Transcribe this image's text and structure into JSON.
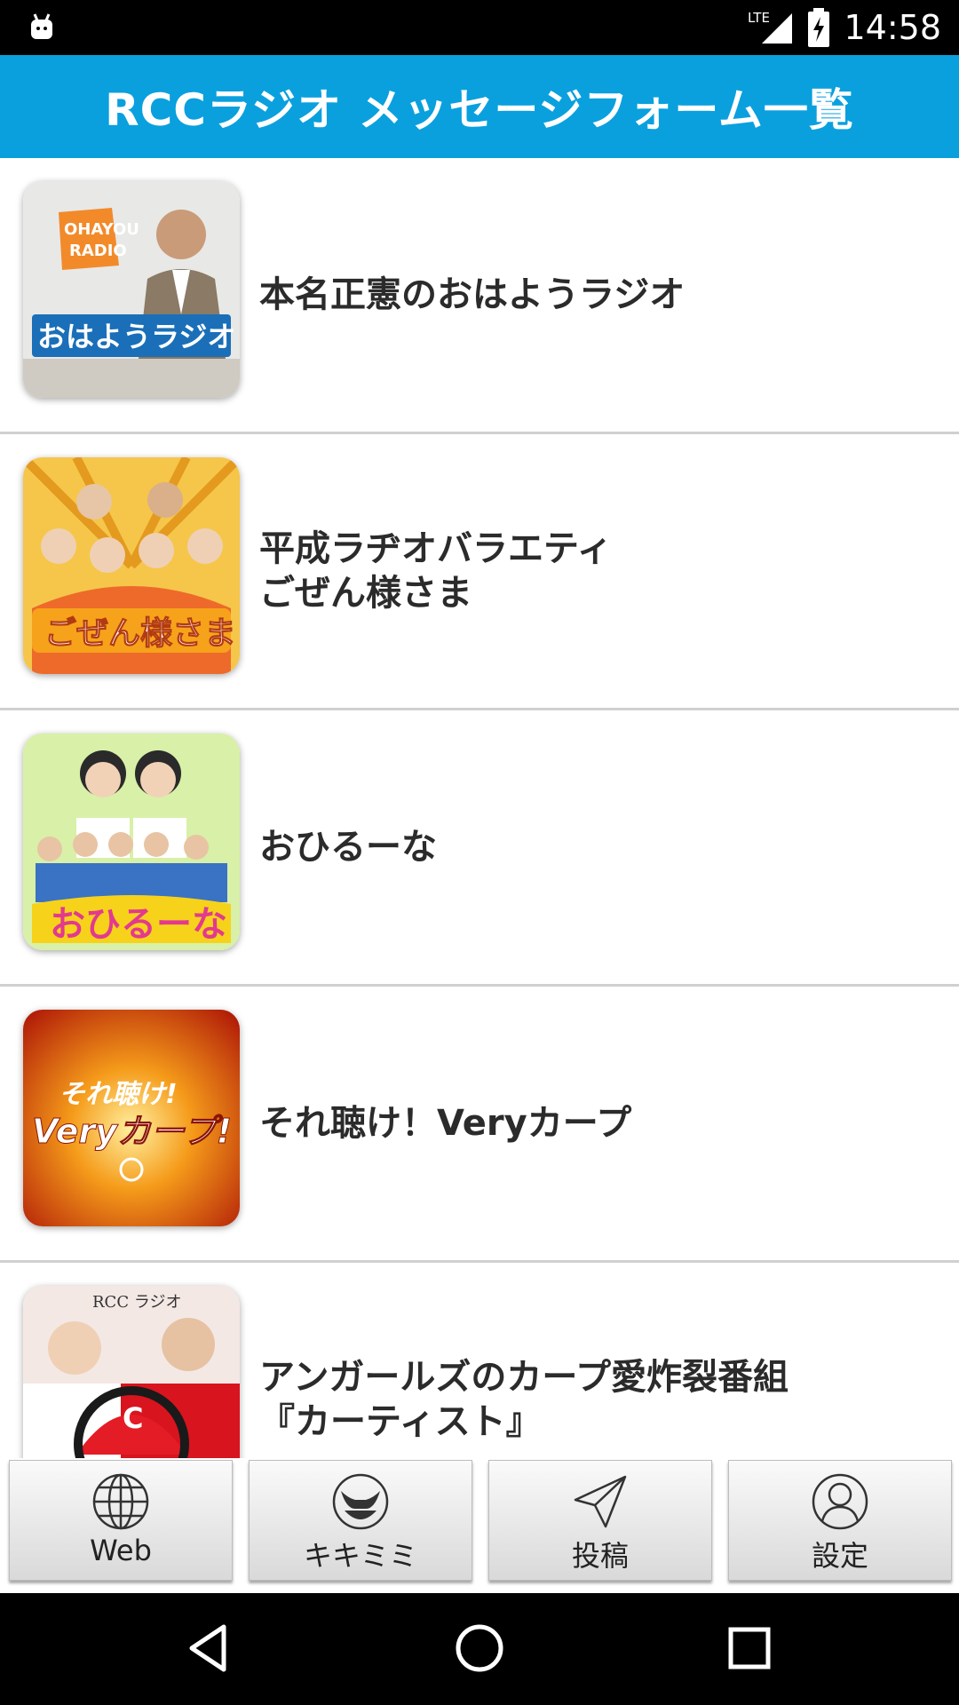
{
  "status_bar": {
    "time": "14:58",
    "network": "LTE",
    "icons": [
      "android-notification-icon",
      "lte-signal-icon",
      "battery-charging-icon"
    ]
  },
  "app_bar": {
    "title": "RCCラジオ メッセージフォーム一覧"
  },
  "programs": [
    {
      "title": "本名正憲のおはようラジオ",
      "thumb_icon": "ohayou-radio-thumbnail",
      "thumb_text": "おはようラジオ"
    },
    {
      "title": "平成ラヂオバラエティ\nごぜん様さま",
      "thumb_icon": "gozen-samasama-thumbnail",
      "thumb_text": "ごぜん様さま"
    },
    {
      "title": "おひるーな",
      "thumb_icon": "ohiruna-thumbnail",
      "thumb_text": "おひるーな"
    },
    {
      "title": "それ聴け！Veryカープ",
      "thumb_icon": "sorekike-very-carp-thumbnail",
      "thumb_text": "Veryカープ!"
    },
    {
      "title": "アンガールズのカープ愛炸裂番組\n『カーティスト』",
      "thumb_icon": "carptist-thumbnail",
      "thumb_text": "RCC ラジオ"
    }
  ],
  "tabs": [
    {
      "label": "Web",
      "icon": "globe-icon"
    },
    {
      "label": "キキミミ",
      "icon": "kikimimi-icon"
    },
    {
      "label": "投稿",
      "icon": "paper-plane-icon"
    },
    {
      "label": "設定",
      "icon": "user-icon"
    }
  ],
  "colors": {
    "app_bar": "#0aa0de",
    "title_text": "#2b2b2b",
    "divider": "#d0d0d0"
  }
}
